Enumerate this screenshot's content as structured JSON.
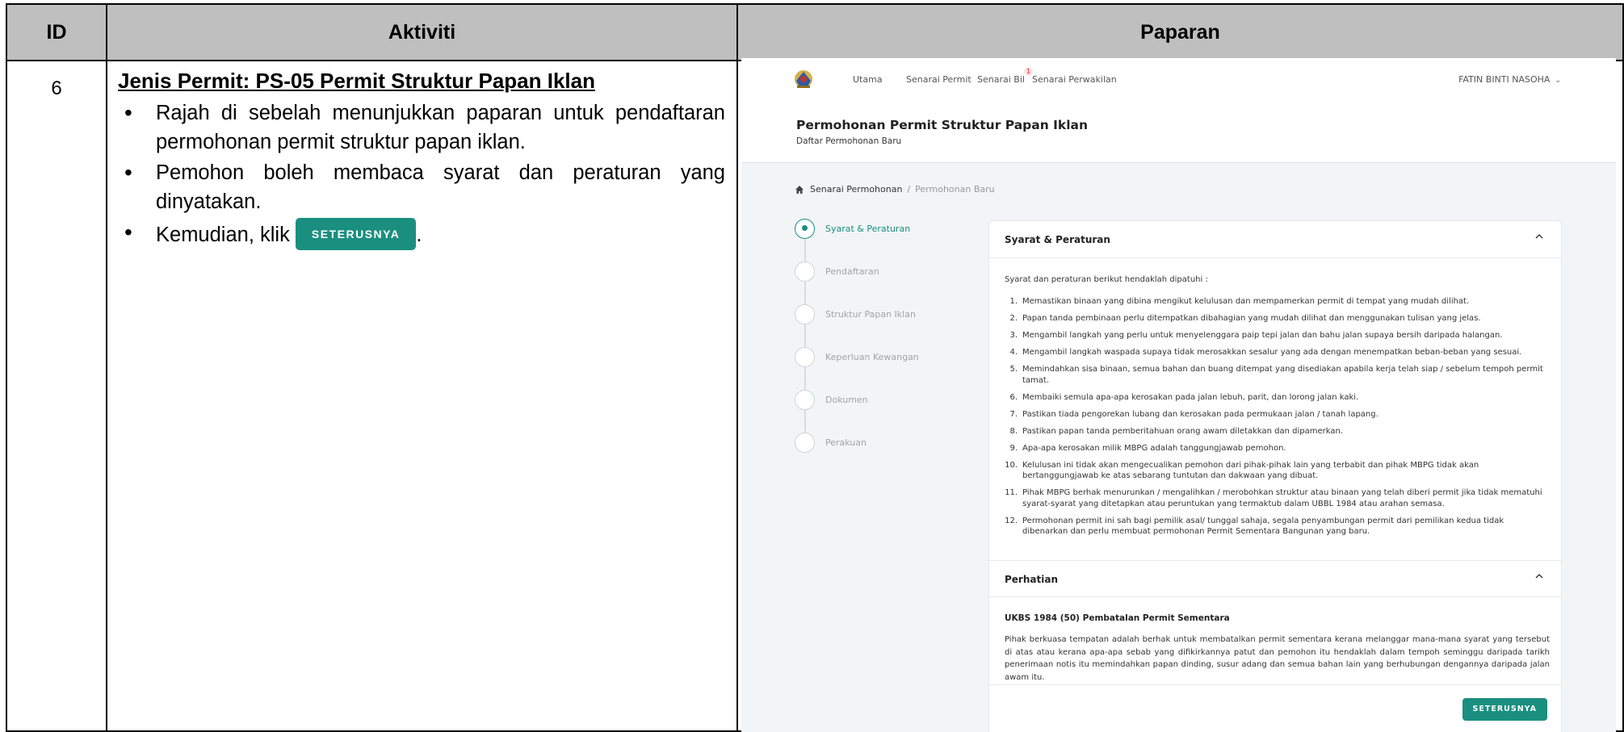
{
  "table": {
    "headers": {
      "id": "ID",
      "activity": "Aktiviti",
      "display": "Paparan"
    },
    "row": {
      "id": "6",
      "title": "Jenis Permit: PS-05 Permit Struktur Papan Iklan",
      "bullets": [
        "Rajah di sebelah menunjukkan paparan untuk pendaftaran permohonan permit struktur papan iklan.",
        "Pemohon boleh membaca syarat dan peraturan yang dinyatakan."
      ],
      "bullet3_prefix": "Kemudian, klik",
      "bullet3_button": "SETERUSNYA",
      "bullet3_suffix": "."
    }
  },
  "screenshot": {
    "nav": {
      "items": [
        "Utama",
        "Senarai Permit",
        "Senarai Bil",
        "Senarai Perwakilan"
      ],
      "badge_count": "1",
      "user_name": "FATIN BINTI NASOHA"
    },
    "page_title": "Permohonan Permit Struktur Papan Iklan",
    "page_subtitle": "Daftar Permohonan Baru",
    "breadcrumb": {
      "root": "Senarai Permohonan",
      "separator": "/",
      "current": "Permohonan Baru"
    },
    "steps": [
      {
        "label": "Syarat & Peraturan",
        "active": true
      },
      {
        "label": "Pendaftaran",
        "active": false
      },
      {
        "label": "Struktur Papan Iklan",
        "active": false
      },
      {
        "label": "Keperluan Kewangan",
        "active": false
      },
      {
        "label": "Dokumen",
        "active": false
      },
      {
        "label": "Perakuan",
        "active": false
      }
    ],
    "section1": {
      "title": "Syarat & Peraturan",
      "intro": "Syarat dan peraturan berikut hendaklah dipatuhi :",
      "rules": [
        "Memastikan binaan yang dibina mengikut kelulusan dan mempamerkan permit di tempat yang mudah dilihat.",
        "Papan tanda pembinaan perlu ditempatkan dibahagian yang mudah dilihat dan menggunakan tulisan yang jelas.",
        "Mengambil langkah yang perlu untuk menyelenggara paip tepi jalan dan bahu jalan supaya bersih daripada halangan.",
        "Mengambil langkah waspada supaya tidak merosakkan sesalur yang ada dengan menempatkan beban-beban yang sesuai.",
        "Memindahkan sisa binaan, semua bahan dan buang ditempat yang disediakan apabila kerja telah siap / sebelum tempoh permit tamat.",
        "Membaiki semula apa-apa kerosakan pada jalan lebuh, parit, dan lorong jalan kaki.",
        "Pastikan tiada pengorekan lubang dan kerosakan pada permukaan jalan / tanah lapang.",
        "Pastikan papan tanda pemberitahuan orang awam diletakkan dan dipamerkan.",
        "Apa-apa kerosakan milik MBPG adalah tanggungjawab pemohon.",
        "Kelulusan ini tidak akan mengecualikan pemohon dari pihak-pihak lain yang terbabit dan pihak MBPG tidak akan bertanggungjawab ke atas sebarang tuntutan dan dakwaan yang dibuat.",
        "Pihak MBPG berhak menurunkan / mengalihkan / merobohkan struktur atau binaan yang telah diberi permit jika tidak mematuhi syarat-syarat yang ditetapkan atau peruntukan yang termaktub dalam UBBL 1984 atau arahan semasa.",
        "Permohonan permit ini sah bagi pemilik asal/ tunggal sahaja, segala penyambungan permit dari pemilikan kedua tidak dibenarkan dan perlu membuat permohonan Permit Sementara Bangunan yang baru."
      ]
    },
    "section2": {
      "title": "Perhatian",
      "subtitle": "UKBS 1984 (50) Pembatalan Permit Sementara",
      "body": "Pihak berkuasa tempatan adalah berhak untuk membatalkan permit sementara kerana melanggar mana-mana syarat yang tersebut di atas atau kerana apa-apa sebab yang difikirkannya patut dan pemohon itu hendaklah dalam tempoh seminggu daripada tarikh penerimaan notis itu memindahkan papan dinding, susur adang dan semua bahan lain yang berhubungan dengannya daripada jalan awam itu."
    },
    "next_button": "SETERUSNYA",
    "accent_color": "#1a8f80"
  }
}
